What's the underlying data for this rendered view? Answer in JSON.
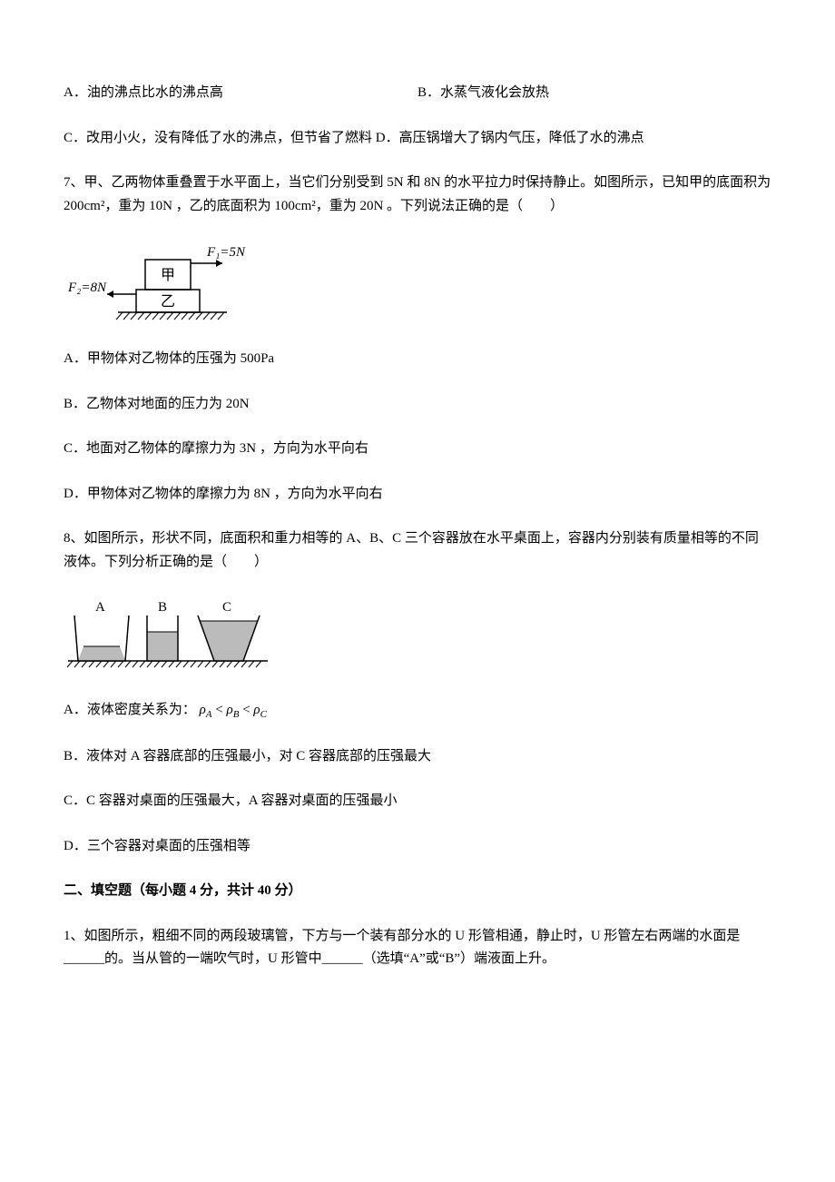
{
  "q6_row1_a": "A．油的沸点比水的沸点高",
  "q6_row1_b": "B．水蒸气液化会放热",
  "q6_row2": "C．改用小火，没有降低了水的沸点，但节省了燃料 D．高压锅增大了锅内气压，降低了水的沸点",
  "q7_stem": "7、甲、乙两物体重叠置于水平面上，当它们分别受到 5N 和 8N 的水平拉力时保持静止。如图所示，已知甲的底面积为 200cm²，重为 10N ，乙的底面积为 100cm²，重为 20N 。下列说法正确的是（　　）",
  "q7_fig": {
    "f1": "F₁=5N",
    "f2": "F₂=8N",
    "box1": "甲",
    "box2": "乙"
  },
  "q7_a": "A．甲物体对乙物体的压强为 500Pa",
  "q7_b": "B．乙物体对地面的压力为 20N",
  "q7_c": "C．地面对乙物体的摩擦力为 3N ，方向为水平向右",
  "q7_d": "D．甲物体对乙物体的摩擦力为 8N ，方向为水平向右",
  "q8_stem": "8、如图所示，形状不同，底面积和重力相等的 A、B、C 三个容器放在水平桌面上，容器内分别装有质量相等的不同液体。下列分析正确的是（　　）",
  "q8_fig": {
    "a": "A",
    "b": "B",
    "c": "C"
  },
  "q8_a_pre": "A．液体密度关系为：",
  "q8_a_rho": "ρ",
  "q8_a_lt": " < ",
  "q8_b": "B．液体对 A 容器底部的压强最小，对 C 容器底部的压强最大",
  "q8_c": "C．C 容器对桌面的压强最大，A 容器对桌面的压强最小",
  "q8_d": "D．三个容器对桌面的压强相等",
  "section2": "二、填空题（每小题 4 分，共计 40 分）",
  "s2_q1": "1、如图所示，粗细不同的两段玻璃管，下方与一个装有部分水的 U 形管相通，静止时，U 形管左右两端的水面是______的。当从管的一端吹气时，U 形管中______（选填“A”或“B”）端液面上升。"
}
